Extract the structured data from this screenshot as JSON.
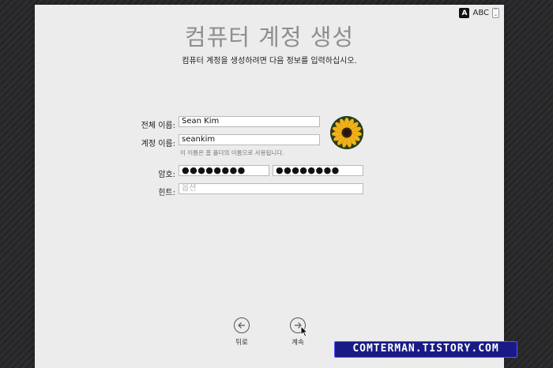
{
  "window": {
    "title": "컴퓨터 계정 생성",
    "subtitle": "컴퓨터 계정을 생성하려면 다음 정보를 입력하십시오."
  },
  "input_source": {
    "badge": "A",
    "name": "ABC",
    "chevron": "◇"
  },
  "form": {
    "full_name_label": "전체 이름:",
    "full_name_value": "Sean Kim",
    "account_name_label": "계정 이름:",
    "account_name_value": "seankim",
    "account_hint": "이 이름은 홈 폴더의 이름으로 사용됩니다.",
    "password_label": "암호:",
    "password_value": "●●●●●●●●",
    "verify_value": "●●●●●●●●",
    "hint_label": "힌트:",
    "hint_placeholder": "옵션"
  },
  "avatar": {
    "icon": "sunflower-icon"
  },
  "nav": {
    "back_label": "뒤로",
    "continue_label": "계속"
  },
  "watermark": {
    "text": "COMTERMAN.TISTORY.COM"
  },
  "colors": {
    "sheet": "#ececec",
    "watermark_bg": "#1a1a86",
    "background": "#2b2b2d"
  }
}
